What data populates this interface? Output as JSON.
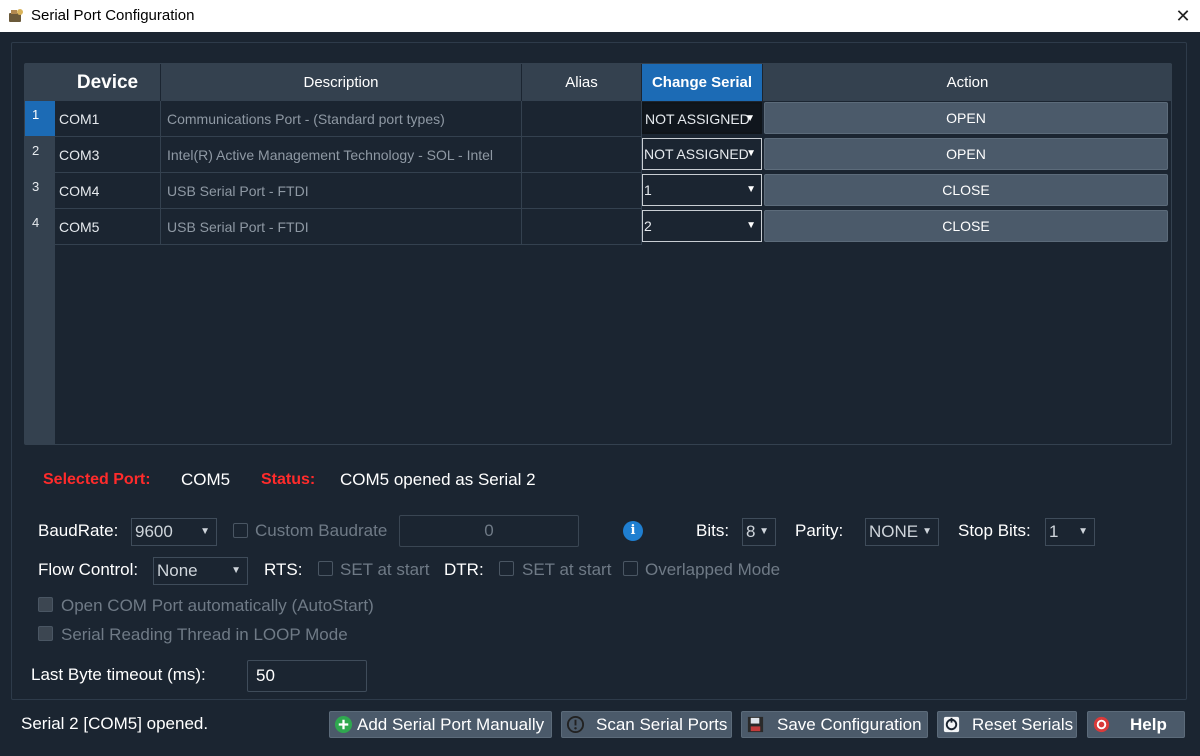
{
  "window": {
    "title": "Serial Port Configuration",
    "app_icon": "app-icon",
    "close_icon": "close-icon"
  },
  "table": {
    "headers": [
      "Device",
      "Description",
      "Alias",
      "Change Serial",
      "Action"
    ],
    "rows": [
      {
        "num": "1",
        "device": "COM1",
        "description": "Communications Port - (Standard port types)",
        "alias": "",
        "serial": "NOT ASSIGNED",
        "action": "OPEN",
        "selected": true
      },
      {
        "num": "2",
        "device": "COM3",
        "description": "Intel(R) Active Management Technology - SOL - Intel",
        "alias": "",
        "serial": "NOT ASSIGNED",
        "action": "OPEN"
      },
      {
        "num": "3",
        "device": "COM4",
        "description": "USB Serial Port - FTDI",
        "alias": "",
        "serial": "1",
        "action": "CLOSE"
      },
      {
        "num": "4",
        "device": "COM5",
        "description": "USB Serial Port - FTDI",
        "alias": "",
        "serial": "2",
        "action": "CLOSE"
      }
    ]
  },
  "selected": {
    "port_label": "Selected Port:",
    "port_value": "COM5",
    "status_label": "Status:",
    "status_value": "COM5 opened as Serial 2"
  },
  "settings": {
    "baud_label": "BaudRate:",
    "baud_value": "9600",
    "custom_baud_label": "Custom Baudrate",
    "custom_baud_value": "0",
    "bits_label": "Bits:",
    "bits_value": "8",
    "parity_label": "Parity:",
    "parity_value": "NONE",
    "stop_label": "Stop Bits:",
    "stop_value": "1",
    "flow_label": "Flow Control:",
    "flow_value": "None",
    "rts_label": "RTS:",
    "rts_check": "SET at start",
    "dtr_label": "DTR:",
    "dtr_check": "SET at start",
    "overlapped": "Overlapped Mode",
    "autostart": "Open COM Port automatically (AutoStart)",
    "loop_mode": "Serial Reading Thread in LOOP Mode",
    "timeout_label": "Last Byte timeout (ms):",
    "timeout_value": "50"
  },
  "footer": {
    "status": "Serial 2 [COM5] opened.",
    "buttons": [
      "Add Serial Port Manually",
      "Scan Serial Ports",
      "Save Configuration",
      "Reset Serials",
      "Help"
    ]
  },
  "colors": {
    "accent": "#1c6bb5",
    "label_red": "#ff2b2b",
    "background": "#1b2531"
  }
}
